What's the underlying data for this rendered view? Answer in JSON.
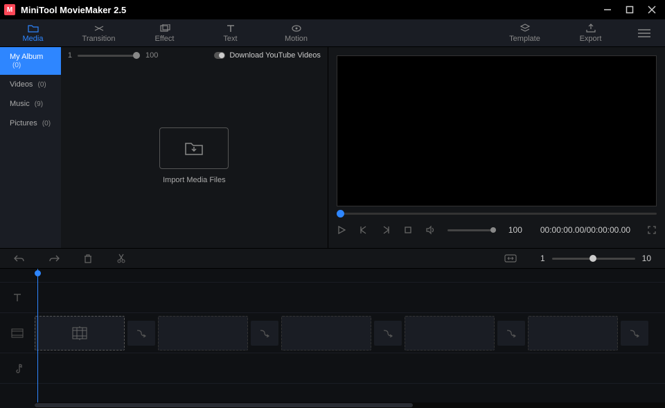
{
  "app": {
    "title": "MiniTool MovieMaker 2.5"
  },
  "tabs": {
    "media": "Media",
    "transition": "Transition",
    "effect": "Effect",
    "text": "Text",
    "motion": "Motion",
    "template": "Template",
    "export": "Export"
  },
  "sidebar": {
    "myalbum": {
      "label": "My Album",
      "count": "(0)"
    },
    "videos": {
      "label": "Videos",
      "count": "(0)"
    },
    "music": {
      "label": "Music",
      "count": "(9)"
    },
    "pictures": {
      "label": "Pictures",
      "count": "(0)"
    }
  },
  "media": {
    "zoom_min": "1",
    "zoom_max": "100",
    "download_label": "Download YouTube Videos",
    "import_label": "Import Media Files"
  },
  "preview": {
    "volume": "100",
    "timecode": "00:00:00.00/00:00:00.00"
  },
  "timeline": {
    "zoom_min": "1",
    "zoom_max": "10"
  }
}
